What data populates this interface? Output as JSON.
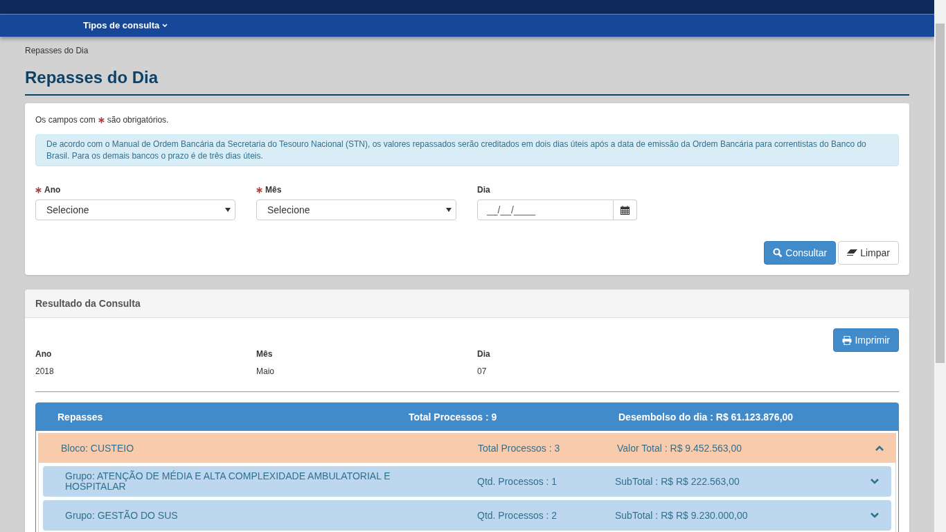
{
  "nav": {
    "menu": "Tipos de consulta"
  },
  "breadcrumb": "Repasses do Dia",
  "title": "Repasses do Dia",
  "form": {
    "required_note_before": "Os campos com",
    "required_note_after": "são obrigatórios.",
    "info": "De acordo com o Manual de Ordem Bancária da Secretaria do Tesouro Nacional (STN), os valores repassados serão creditados em dois dias úteis após a data de emissão da Ordem Bancária para correntistas do Banco do Brasil. Para os demais bancos o prazo é de três dias úteis.",
    "fields": [
      {
        "kind": "select",
        "label": "Ano",
        "required": true,
        "value": "Selecione"
      },
      {
        "kind": "select",
        "label": "Mês",
        "required": true,
        "value": "Selecione"
      },
      {
        "kind": "date",
        "label": "Dia",
        "required": false,
        "placeholder": "__/__/____"
      }
    ],
    "buttons": [
      {
        "kind": "primary",
        "label": "Consultar"
      },
      {
        "kind": "default",
        "label": "Limpar"
      }
    ]
  },
  "result": {
    "title": "Resultado da Consulta",
    "print_button": "Imprimir",
    "summary": [
      {
        "label": "Ano",
        "value": "2018"
      },
      {
        "label": "Mês",
        "value": "Maio"
      },
      {
        "label": "Dia",
        "value": "07"
      }
    ],
    "repasses": {
      "label": "Repasses",
      "total": "Total Processos : 9",
      "desembolso": "Desembolso do dia : R$ 61.123.876,00",
      "blocos": [
        {
          "label": "Bloco: CUSTEIO",
          "total": "Total Processos : 3",
          "valor": "Valor Total : R$ 9.452.563,00",
          "expanded": true,
          "grupos": [
            {
              "label": "Grupo: ATENÇÃO DE MÉDIA E ALTA COMPLEXIDADE AMBULATORIAL E HOSPITALAR",
              "qtd": "Qtd. Processos : 1",
              "subtotal": "SubTotal : R$ R$ 222.563,00",
              "expanded": false
            },
            {
              "label": "Grupo: GESTÃO DO SUS",
              "qtd": "Qtd. Processos : 2",
              "subtotal": "SubTotal : R$ R$ 9.230.000,00",
              "expanded": false
            }
          ]
        }
      ]
    }
  }
}
